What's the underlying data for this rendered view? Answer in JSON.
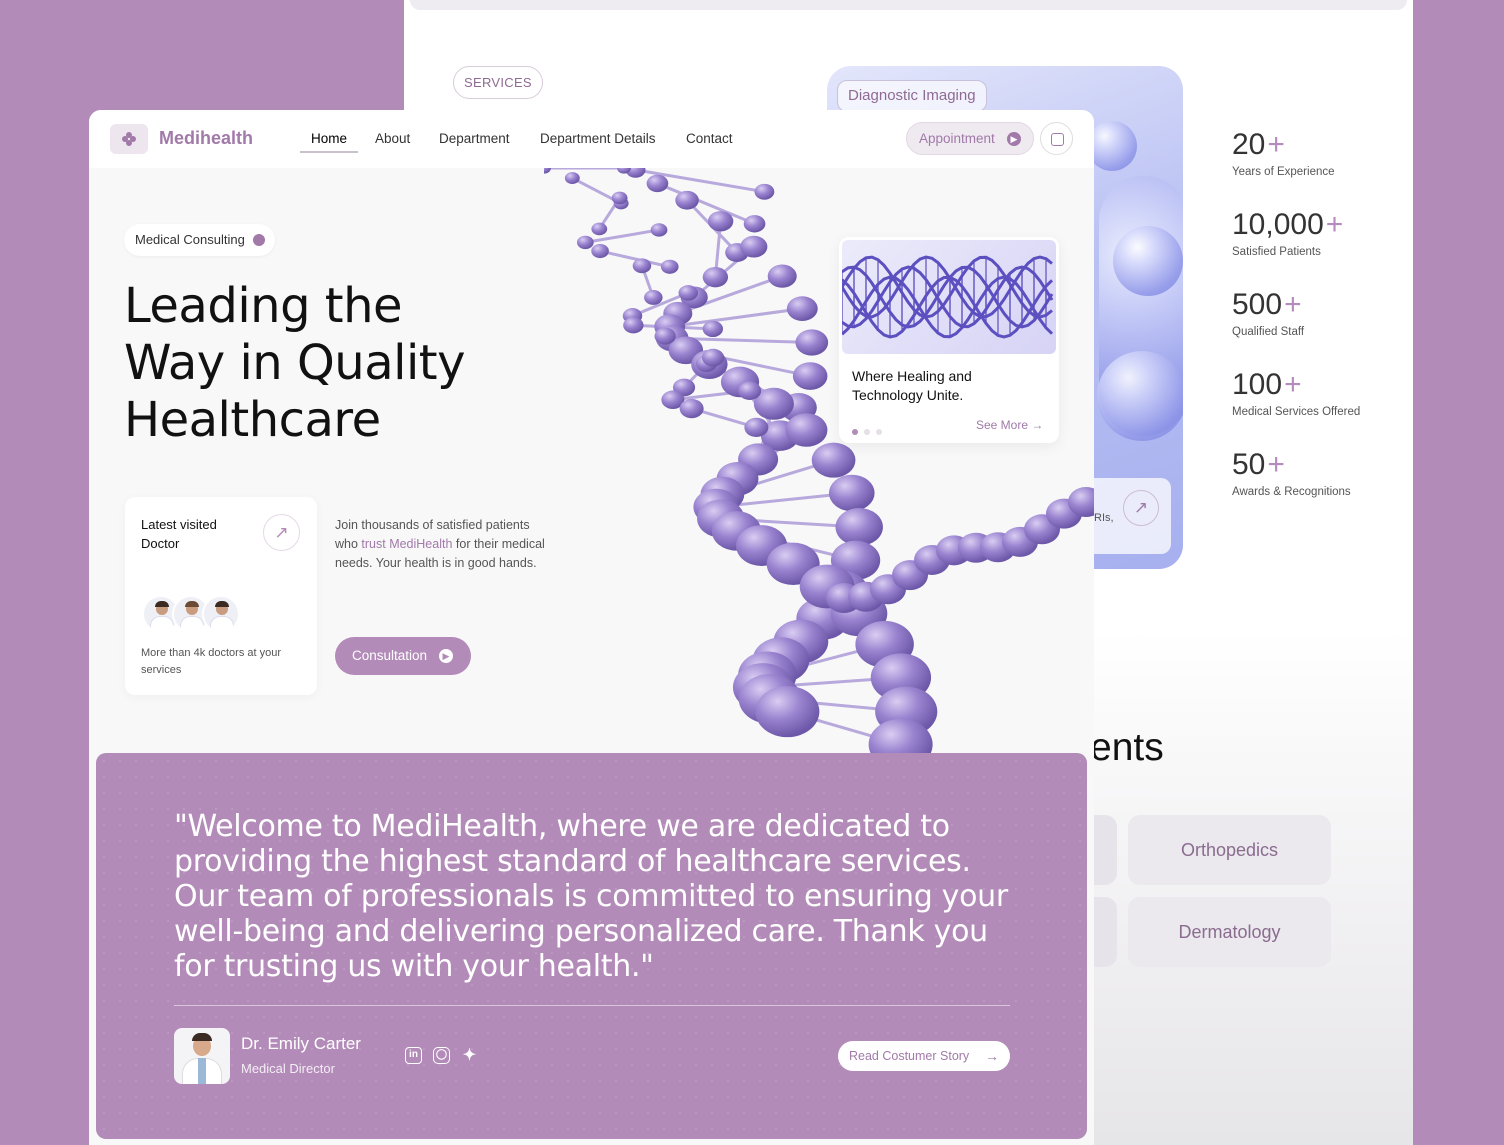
{
  "back": {
    "services_label": "SERVICES",
    "diagnostic_label": "Diagnostic Imaging",
    "diagnostic_snippet": "IRIs,",
    "stats": [
      {
        "value": "20",
        "suffix": "+",
        "label": "Years of Experience"
      },
      {
        "value": "10,000",
        "suffix": "+",
        "label": "Satisfied Patients"
      },
      {
        "value": "500",
        "suffix": "+",
        "label": "Qualified Staff"
      },
      {
        "value": "100",
        "suffix": "+",
        "label": "Medical Services Offered"
      },
      {
        "value": "50",
        "suffix": "+",
        "label": "Awards & Recognitions"
      }
    ],
    "departments_heading_fragment": "ents",
    "departments": [
      "Orthopedics",
      "Dermatology"
    ]
  },
  "nav": {
    "brand": "Medihealth",
    "items": [
      "Home",
      "About",
      "Department",
      "Department Details",
      "Contact"
    ],
    "active": "Home",
    "appointment_label": "Appointment"
  },
  "hero": {
    "badge": "Medical Consulting",
    "title_lines": [
      "Leading the",
      "Way in Quality",
      "Healthcare"
    ],
    "doctor_card": {
      "title": "Latest visited Doctor",
      "footer": "More than 4k doctors at your services"
    },
    "description_before": "Join thousands of satisfied patients who ",
    "description_highlight": "trust MediHealth",
    "description_after": " for their medical needs. Your health is in good hands.",
    "cta": "Consultation",
    "feature_card": {
      "title": "Where Healing and Technology Unite.",
      "link": "See More",
      "slides": 3,
      "active_slide": 1
    }
  },
  "quote": {
    "text": "\"Welcome to MediHealth, where we are dedicated to providing the highest standard of healthcare services. Our team of professionals is committed to ensuring your well-being and delivering personalized care. Thank you for trusting us with your health.\"",
    "author": "Dr. Emily Carter",
    "role": "Medical Director",
    "social": [
      "linkedin-icon",
      "instagram-icon",
      "twitter-icon"
    ],
    "cta": "Read Costumer Story"
  },
  "colors": {
    "brand": "#a27aa9",
    "background": "#b38bb8",
    "accent_soft": "#efe9f0",
    "dna": "#8d74c4"
  }
}
